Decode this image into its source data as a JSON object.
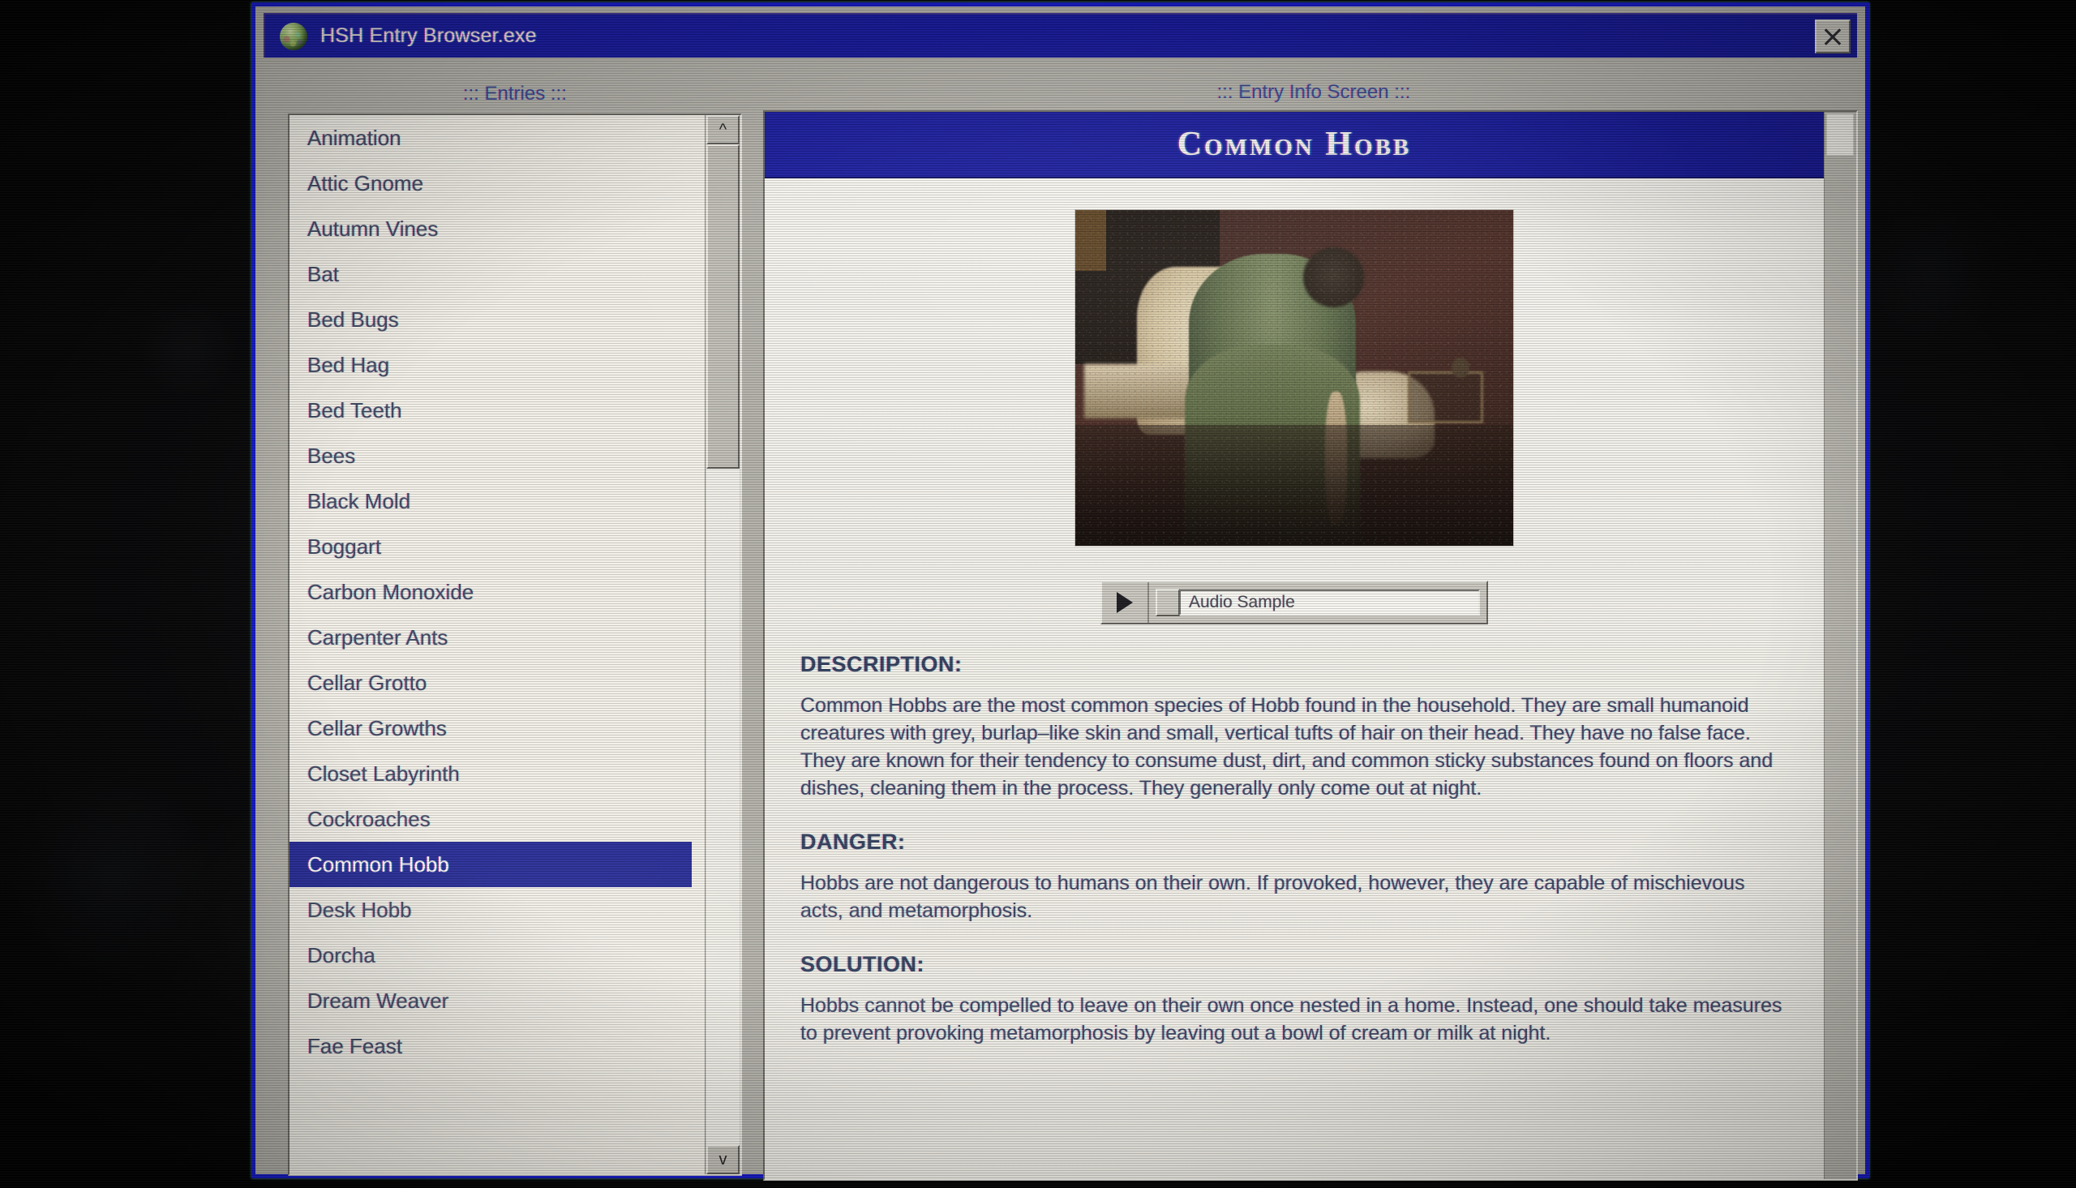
{
  "window": {
    "title": "HSH Entry Browser.exe",
    "icon": "brain-sphere-icon",
    "close_label": "Close",
    "border_color": "#1519c8",
    "titlebar_color": "#181a9e"
  },
  "panels": {
    "entries_caption": "::: Entries :::",
    "info_caption": "::: Entry Info Screen :::"
  },
  "entries": {
    "selected": "Common Hobb",
    "items": [
      "Animation",
      "Attic Gnome",
      "Autumn Vines",
      "Bat",
      "Bed Bugs",
      "Bed Hag",
      "Bed Teeth",
      "Bees",
      "Black Mold",
      "Boggart",
      "Carbon Monoxide",
      "Carpenter Ants",
      "Cellar Grotto",
      "Cellar Growths",
      "Closet Labyrinth",
      "Cockroaches",
      "Common Hobb",
      "Desk Hobb",
      "Dorcha",
      "Dream Weaver",
      "Fae Feast"
    ],
    "scroll_up_glyph": "^",
    "scroll_down_glyph": "v"
  },
  "entry": {
    "title": "Common Hobb",
    "photo_alt": "grainy photograph of a dim room with a green chair and pale pillow",
    "audio": {
      "play_glyph": "play-triangle",
      "label": "Audio Sample"
    },
    "sections": [
      {
        "heading": "DESCRIPTION:",
        "body": "Common Hobbs are the most common species of Hobb found in the household. They are small humanoid creatures with grey, burlap–like skin and small, vertical tufts of hair on their head. They have no false face. They are known for their tendency to consume dust, dirt, and common sticky substances found on floors and dishes, cleaning them in the process. They generally only come out at night."
      },
      {
        "heading": "DANGER:",
        "body": "Hobbs are not dangerous to humans on their own. If provoked, however, they are capable of mischievous acts, and metamorphosis."
      },
      {
        "heading": "SOLUTION:",
        "body": "Hobbs cannot be compelled to leave on their own once nested in a home. Instead, one should take measures to prevent provoking metamorphosis by leaving out a bowl of cream or milk at night."
      }
    ]
  },
  "colors": {
    "selection": "#252a96",
    "window_face": "#b3b1a9",
    "list_face": "#f2efe7",
    "text": "#3f4a62"
  }
}
